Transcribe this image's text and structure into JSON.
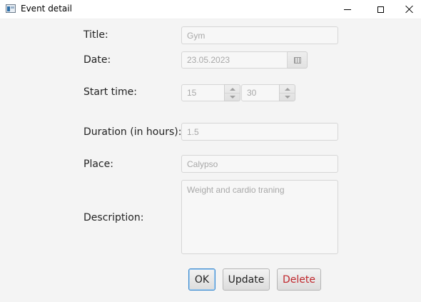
{
  "window": {
    "title": "Event detail"
  },
  "form": {
    "title_label": "Title:",
    "title_value": "Gym",
    "date_label": "Date:",
    "date_value": "23.05.2023",
    "start_time_label": "Start time:",
    "start_hour": "15",
    "start_minute": "30",
    "duration_label": "Duration (in hours):",
    "duration_value": "1.5",
    "place_label": "Place:",
    "place_value": "Calypso",
    "description_label": "Description:",
    "description_value": "Weight and cardio traning"
  },
  "buttons": {
    "ok_label": "OK",
    "update_label": "Update",
    "delete_label": "Delete"
  },
  "colors": {
    "delete_text": "#c0262c",
    "focus_border": "#3a8ad0"
  }
}
